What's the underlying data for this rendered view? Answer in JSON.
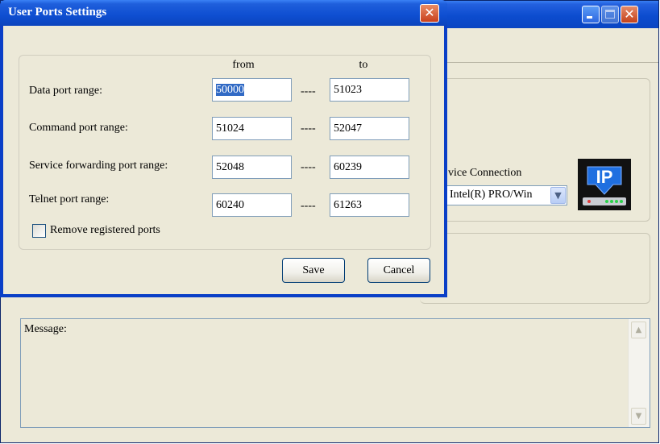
{
  "dialog": {
    "title": "User Ports Settings",
    "columns": {
      "from": "from",
      "to": "to"
    },
    "rows": [
      {
        "label": "Data port range:",
        "from": "50000",
        "to": "51023"
      },
      {
        "label": "Command port range:",
        "from": "51024",
        "to": "52047"
      },
      {
        "label": "Service forwarding port range:",
        "from": "52048",
        "to": "60239"
      },
      {
        "label": "Telnet port range:",
        "from": "60240",
        "to": "61263"
      }
    ],
    "separator": "----",
    "remove_registered": {
      "label": "Remove registered ports",
      "checked": false
    },
    "save_label": "Save",
    "cancel_label": "Cancel"
  },
  "background_window": {
    "service_connection_label": "vice Connection",
    "adapter_selected": "Intel(R) PRO/Win",
    "logo_text": "IP",
    "message_label": "Message:"
  },
  "colors": {
    "titlebar_blue": "#0a44c2",
    "window_face": "#ece9d8",
    "input_border": "#7f9db9",
    "selection": "#316ac5",
    "close_red": "#c9401c"
  },
  "icons": {
    "dialog_close": "close-icon",
    "minimize": "minimize-icon",
    "maximize": "maximize-icon",
    "close": "close-icon",
    "dropdown": "chevron-down-icon",
    "scroll_up": "chevron-up-icon",
    "scroll_down": "chevron-down-icon"
  }
}
